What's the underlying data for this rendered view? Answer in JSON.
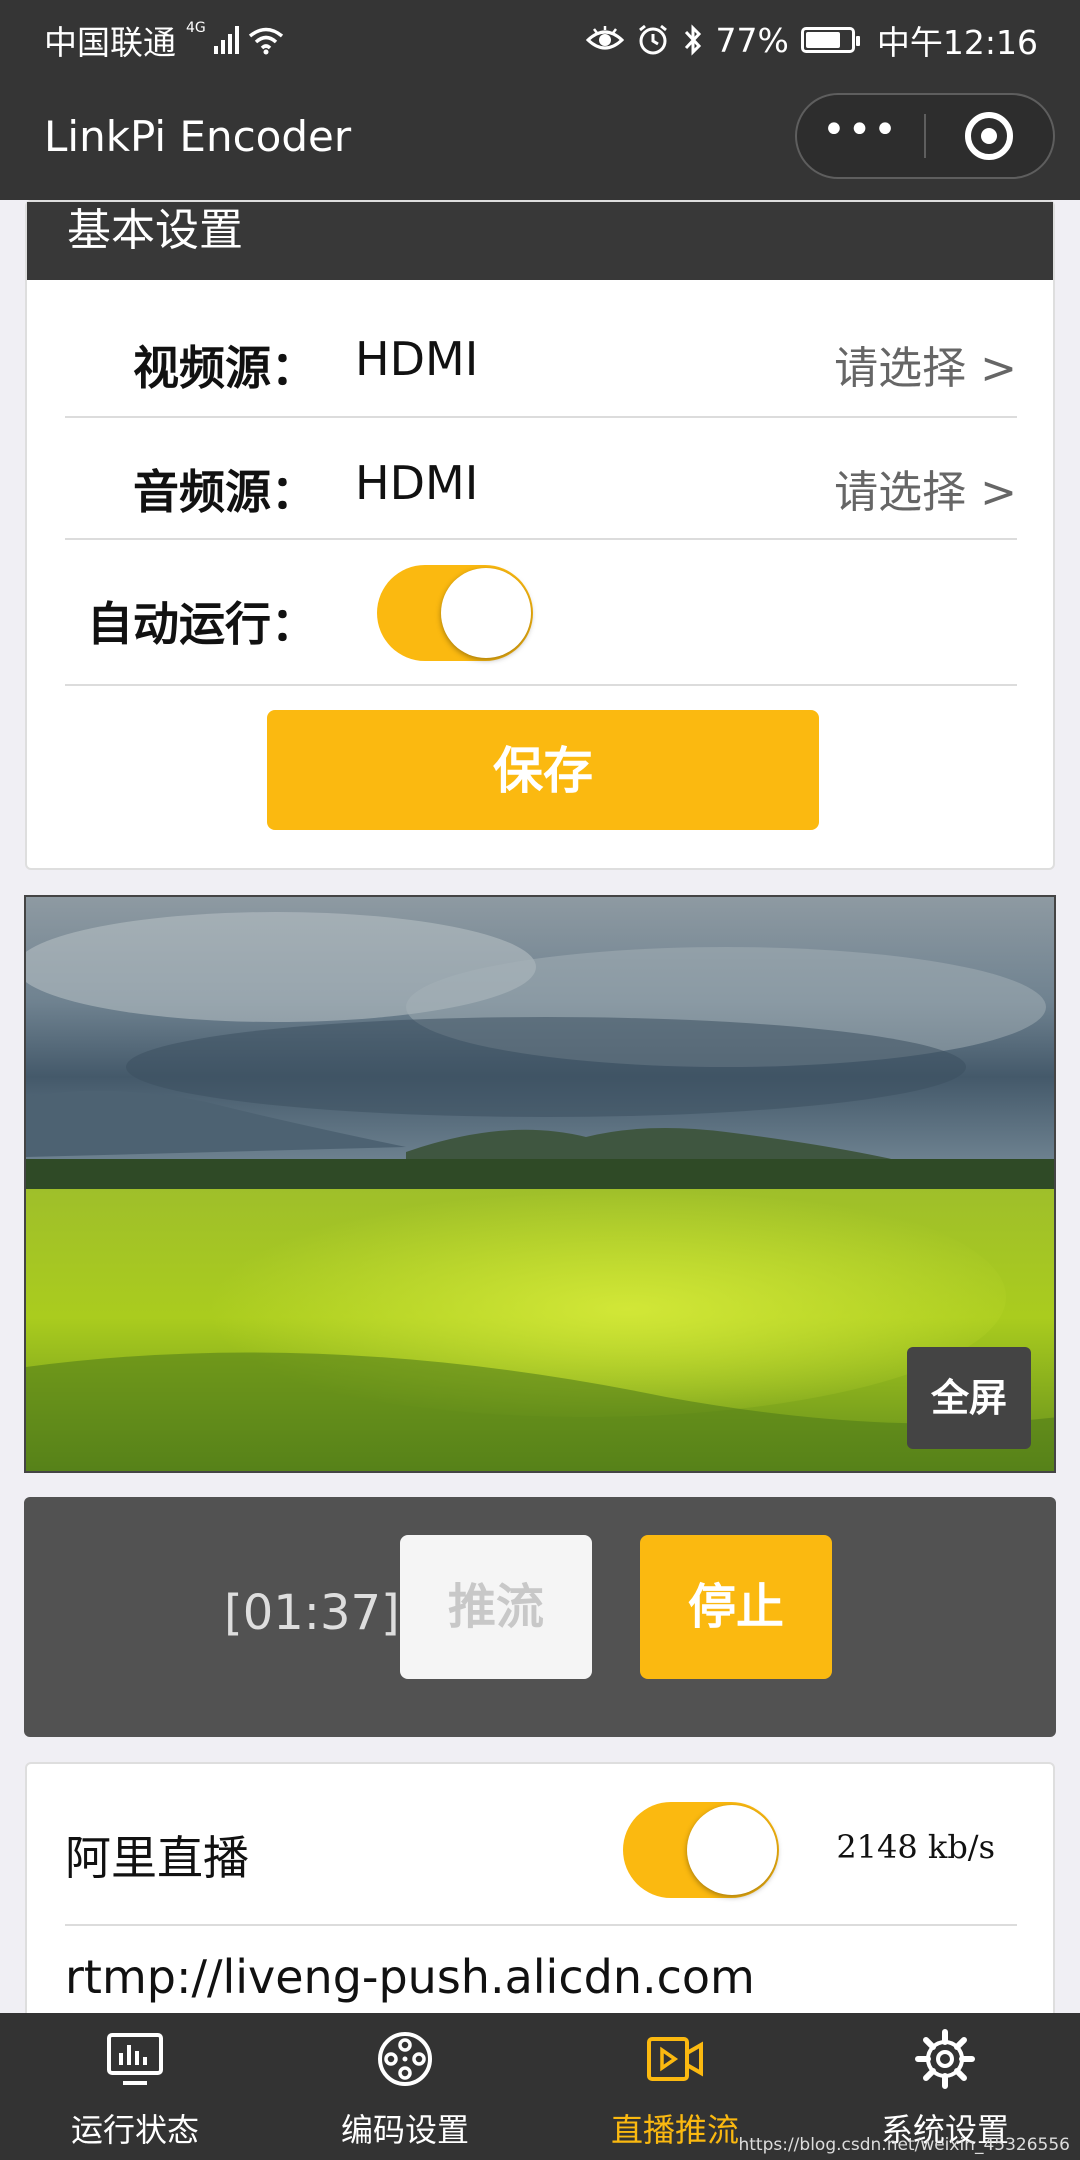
{
  "status_bar": {
    "carrier": "中国联通",
    "network": "4G",
    "battery": "77%",
    "time": "中午12:16",
    "battery_level": 0.77
  },
  "app": {
    "title": "LinkPi Encoder",
    "more_label": "•••"
  },
  "settings": {
    "header": "基本设置",
    "video_source": {
      "label": "视频源：",
      "value": "HDMI",
      "action": "请选择 >"
    },
    "audio_source": {
      "label": "音频源：",
      "value": "HDMI",
      "action": "请选择 >"
    },
    "auto_run": {
      "label": "自动运行：",
      "enabled": true
    },
    "save_label": "保存"
  },
  "preview": {
    "fullscreen_label": "全屏"
  },
  "push_control": {
    "timer": "[01:37]",
    "push_label": "推流",
    "stop_label": "停止"
  },
  "stream": {
    "name": "阿里直播",
    "enabled": true,
    "bitrate": "2148 kb/s",
    "url": "rtmp://liveng-push.alicdn.com"
  },
  "tabs": [
    {
      "label": "运行状态",
      "icon": "monitor-chart-icon",
      "active": false
    },
    {
      "label": "编码设置",
      "icon": "film-reel-icon",
      "active": false
    },
    {
      "label": "直播推流",
      "icon": "video-camera-icon",
      "active": true
    },
    {
      "label": "系统设置",
      "icon": "gear-icon",
      "active": false
    }
  ],
  "watermark": "https://blog.csdn.net/weixin_45326556",
  "colors": {
    "accent": "#fbb910",
    "navbar": "#353535",
    "panel": "#525252",
    "tabbar": "#333333"
  }
}
